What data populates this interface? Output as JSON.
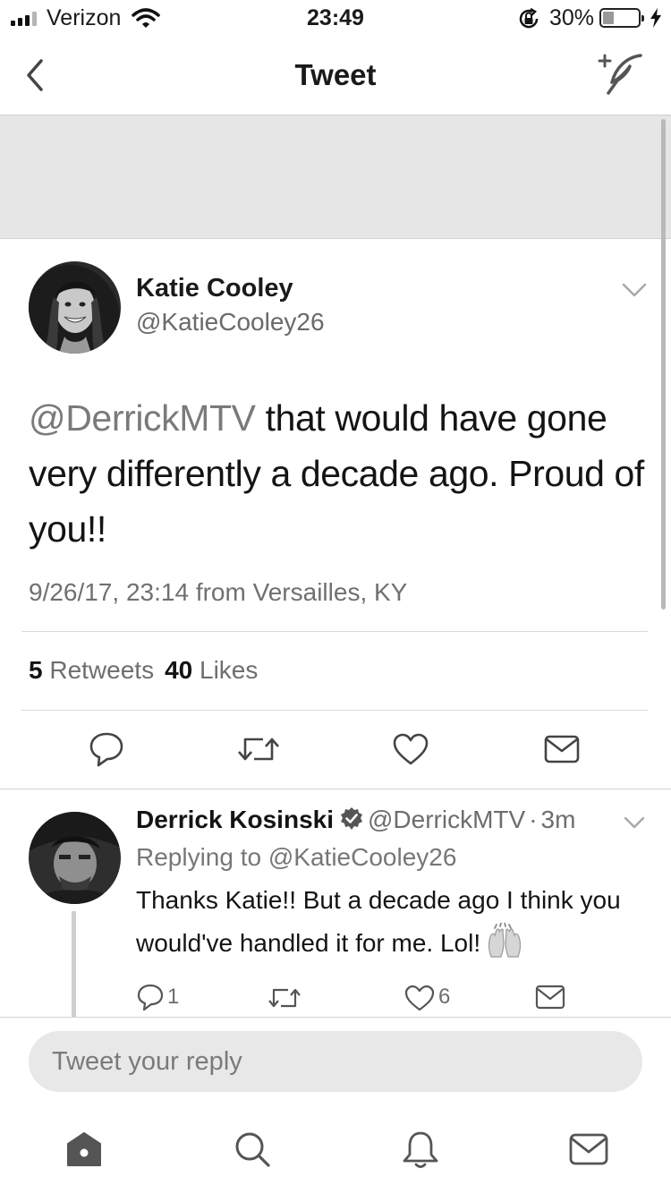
{
  "status_bar": {
    "carrier": "Verizon",
    "time": "23:49",
    "battery_percent": "30%",
    "battery_level": 0.3,
    "signal_bars_active": 3,
    "signal_bars_total": 4,
    "icons": [
      "signal-icon",
      "wifi-icon",
      "rotation-lock-icon",
      "battery-icon",
      "charging-bolt-icon"
    ]
  },
  "nav": {
    "title": "Tweet",
    "icons": {
      "back": "back-chevron-icon",
      "compose": "compose-tweet-icon"
    }
  },
  "tweet": {
    "author": {
      "name": "Katie Cooley",
      "handle": "@KatieCooley26"
    },
    "mention": "@DerrickMTV",
    "text": " that would have gone very differently a decade ago. Proud of you!!",
    "meta": "9/26/17, 23:14 from Versailles, KY",
    "stats": {
      "retweets_count": "5",
      "retweets_label": "Retweets",
      "likes_count": "40",
      "likes_label": "Likes"
    },
    "actions": [
      "reply-icon",
      "retweet-icon",
      "like-icon",
      "direct-message-icon"
    ]
  },
  "reply": {
    "author": {
      "name": "Derrick Kosinski",
      "handle": "@DerrickMTV",
      "time": "3m",
      "separator": "·"
    },
    "replying_label": "Replying to ",
    "replying_to": "@KatieCooley26",
    "text": "Thanks Katie!! But a decade ago I think you would've handled it for me. Lol!",
    "emoji": "raising-hands-emoji",
    "counts": {
      "replies": "1",
      "likes": "6"
    },
    "actions": [
      "reply-icon",
      "retweet-icon",
      "like-icon",
      "direct-message-icon"
    ]
  },
  "compose": {
    "placeholder": "Tweet your reply"
  },
  "tabbar": {
    "tabs": [
      "home-icon",
      "search-icon",
      "notifications-icon",
      "messages-icon"
    ]
  },
  "colors": {
    "text": "#141414",
    "secondary_text": "#6e6e6e",
    "banner": "#e6e6e6",
    "divider": "#dadada",
    "input_background": "#e8e8e8"
  }
}
